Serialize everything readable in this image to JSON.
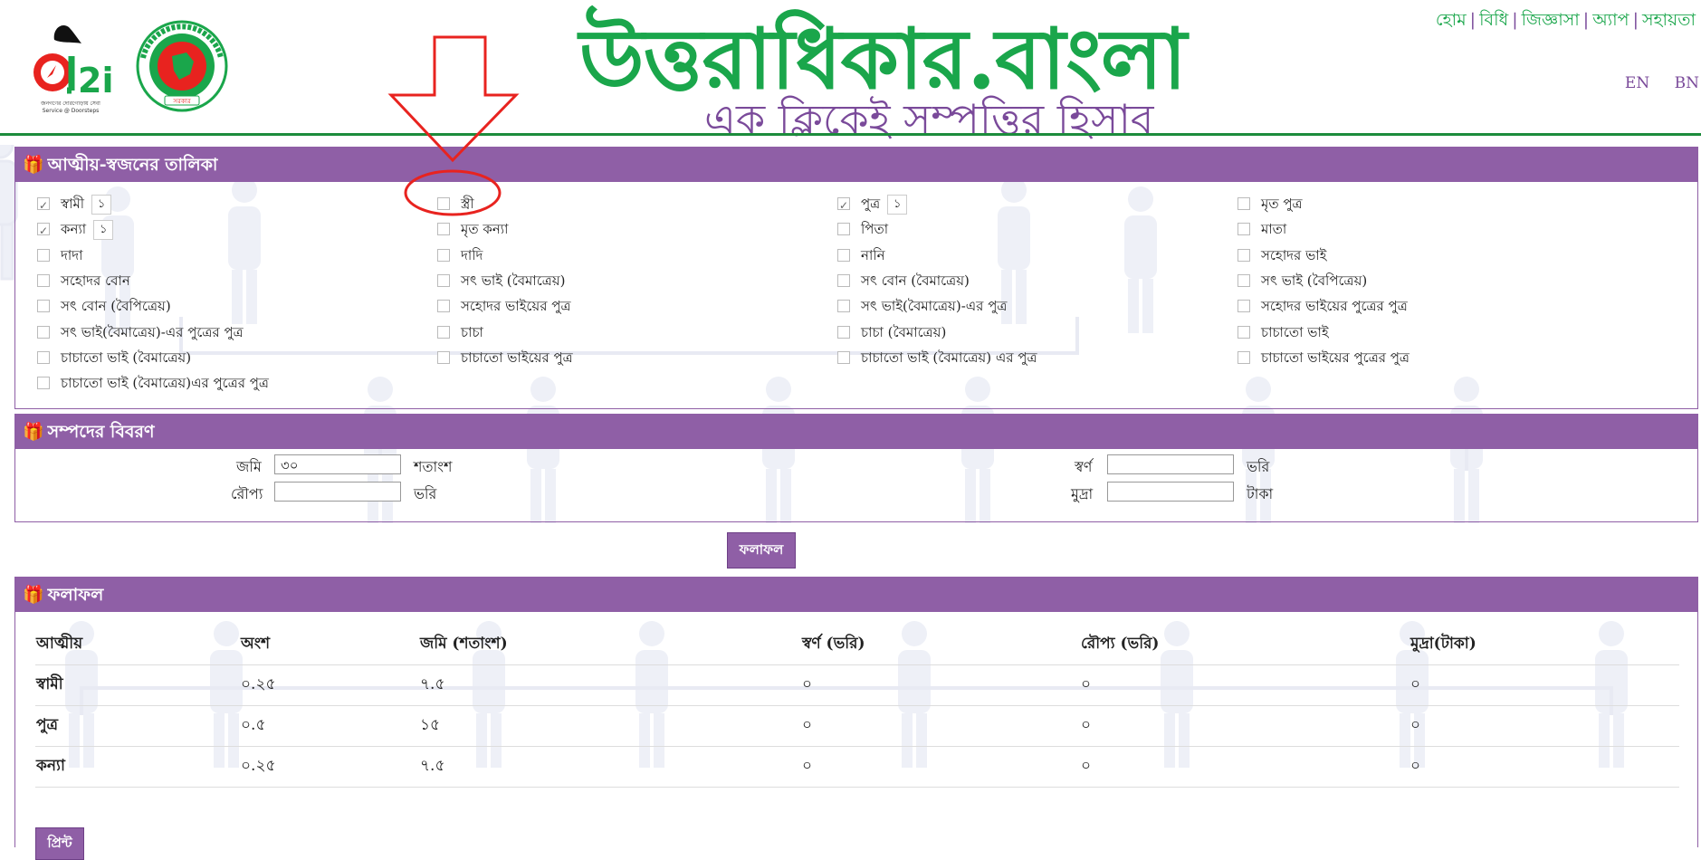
{
  "header": {
    "title": "উত্তরাধিকার.বাংলা",
    "tagline": "এক ক্লিকেই সম্পত্তির হিসাব",
    "nav": [
      "হোম",
      "বিধি",
      "জিজ্ঞাসা",
      "অ্যাপ",
      "সহায়তা"
    ],
    "nav_separator": "|",
    "lang": [
      "EN",
      "BN"
    ],
    "a2i_logo_text": "a2i",
    "a2i_subtext": "Service @ Doorsteps",
    "seal_text": "গণপ্রজাতন্ত্রী বাংলাদেশ সরকার"
  },
  "relatives_panel": {
    "title": "আত্মীয়-স্বজনের তালিকা",
    "items": [
      {
        "label": "স্বামী",
        "checked": true,
        "count": "১"
      },
      {
        "label": "স্ত্রী",
        "checked": false,
        "count": ""
      },
      {
        "label": "পুত্র",
        "checked": true,
        "count": "১"
      },
      {
        "label": "মৃত পুত্র",
        "checked": false,
        "count": ""
      },
      {
        "label": "কন্যা",
        "checked": true,
        "count": "১"
      },
      {
        "label": "মৃত কন্যা",
        "checked": false,
        "count": ""
      },
      {
        "label": "পিতা",
        "checked": false,
        "count": ""
      },
      {
        "label": "মাতা",
        "checked": false,
        "count": ""
      },
      {
        "label": "দাদা",
        "checked": false,
        "count": ""
      },
      {
        "label": "দাদি",
        "checked": false,
        "count": ""
      },
      {
        "label": "নানি",
        "checked": false,
        "count": ""
      },
      {
        "label": "সহোদর ভাই",
        "checked": false,
        "count": ""
      },
      {
        "label": "সহোদর বোন",
        "checked": false,
        "count": ""
      },
      {
        "label": "সৎ ভাই (বৈমাত্রেয়)",
        "checked": false,
        "count": ""
      },
      {
        "label": "সৎ বোন (বৈমাত্রেয়)",
        "checked": false,
        "count": ""
      },
      {
        "label": "সৎ ভাই (বৈপিত্রেয়)",
        "checked": false,
        "count": ""
      },
      {
        "label": "সৎ বোন (বৈপিত্রেয়)",
        "checked": false,
        "count": ""
      },
      {
        "label": "সহোদর ভাইয়ের পুত্র",
        "checked": false,
        "count": ""
      },
      {
        "label": "সৎ ভাই(বৈমাত্রেয়)-এর পুত্র",
        "checked": false,
        "count": ""
      },
      {
        "label": "সহোদর ভাইয়ের পুত্রের পুত্র",
        "checked": false,
        "count": ""
      },
      {
        "label": "সৎ ভাই(বৈমাত্রেয়)-এর পুত্রের পুত্র",
        "checked": false,
        "count": ""
      },
      {
        "label": "চাচা",
        "checked": false,
        "count": ""
      },
      {
        "label": "চাচা (বৈমাত্রেয়)",
        "checked": false,
        "count": ""
      },
      {
        "label": "চাচাতো ভাই",
        "checked": false,
        "count": ""
      },
      {
        "label": "চাচাতো ভাই (বৈমাত্রেয়)",
        "checked": false,
        "count": ""
      },
      {
        "label": "চাচাতো ভাইয়ের পুত্র",
        "checked": false,
        "count": ""
      },
      {
        "label": "চাচাতো ভাই (বৈমাত্রেয়) এর পুত্র",
        "checked": false,
        "count": ""
      },
      {
        "label": "চাচাতো ভাইয়ের পুত্রের পুত্র",
        "checked": false,
        "count": ""
      },
      {
        "label": "চাচাতো ভাই (বৈমাত্রেয়)এর পুত্রের পুত্র",
        "checked": false,
        "count": ""
      }
    ]
  },
  "assets_panel": {
    "title": "সম্পদের বিবরণ",
    "land_label": "জমি",
    "land_value": "৩০",
    "land_unit": "শতাংশ",
    "gold_label": "স্বর্ণ",
    "gold_value": "",
    "gold_unit": "ভরি",
    "silver_label": "রৌপ্য",
    "silver_value": "",
    "silver_unit": "ভরি",
    "money_label": "মুদ্রা",
    "money_value": "",
    "money_unit": "টাকা"
  },
  "calc_button": "ফলাফল",
  "result_panel": {
    "title": "ফলাফল",
    "columns": [
      "আত্মীয়",
      "অংশ",
      "জমি (শতাংশ)",
      "স্বর্ণ (ভরি)",
      "রৌপ্য (ভরি)",
      "মুদ্রা(টাকা)"
    ],
    "rows": [
      [
        "স্বামী",
        "০.২৫",
        "৭.৫",
        "০",
        "০",
        "০"
      ],
      [
        "পুত্র",
        "০.৫",
        "১৫",
        "০",
        "০",
        "০"
      ],
      [
        "কন্যা",
        "০.২৫",
        "৭.৫",
        "০",
        "০",
        "০"
      ]
    ],
    "print_button": "প্রিন্ট"
  },
  "colors": {
    "brand_green": "#1aa64b",
    "brand_purple": "#8f5fa6",
    "annotation_red": "#e8231f"
  }
}
